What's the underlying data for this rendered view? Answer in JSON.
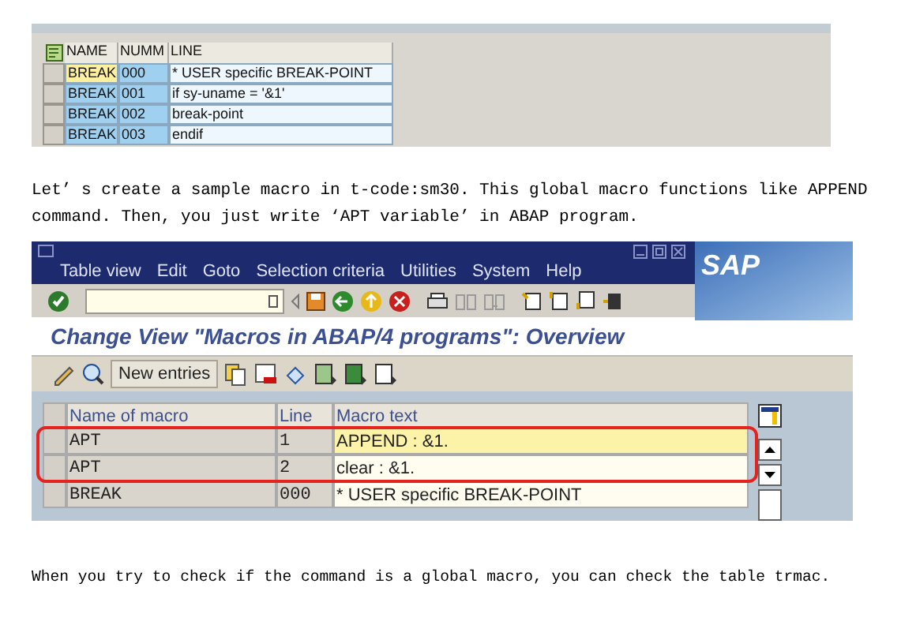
{
  "figure_1": {
    "columns": [
      "NAME",
      "NUMM",
      "LINE"
    ],
    "rows": [
      {
        "cells": [
          "BREAK",
          "000",
          "* USER specific BREAK-POINT"
        ],
        "selected": true
      },
      {
        "cells": [
          "BREAK",
          "001",
          "if sy-uname = '&1'"
        ],
        "selected": false
      },
      {
        "cells": [
          "BREAK",
          "002",
          "break-point"
        ],
        "selected": false
      },
      {
        "cells": [
          "BREAK",
          "003",
          "endif"
        ],
        "selected": false
      }
    ]
  },
  "paragraph_1": "Let’ s create a sample macro in t-code:sm30. This global macro functions like APPEND command. Then, you just write  ‘APT variable’  in ABAP program.",
  "sap_window": {
    "menu": [
      "Table view",
      "Edit",
      "Goto",
      "Selection criteria",
      "Utilities",
      "System",
      "Help"
    ],
    "logo": "SAP",
    "title": "Change View \"Macros in ABAP/4 programs\": Overview",
    "new_entries_button": "New entries",
    "columns": [
      "Name of macro",
      "Line",
      "Macro text"
    ],
    "rows": [
      {
        "cells": [
          "APT",
          "1",
          "APPEND : &1."
        ],
        "selected": true,
        "circled": true
      },
      {
        "cells": [
          "APT",
          "2",
          "clear : &1."
        ],
        "selected": false,
        "circled": true
      },
      {
        "cells": [
          "BREAK",
          "000",
          "* USER specific BREAK-POINT"
        ],
        "selected": false,
        "circled": false
      }
    ]
  },
  "paragraph_2": "When you try to check if the command is a global macro, you can check the table trmac."
}
